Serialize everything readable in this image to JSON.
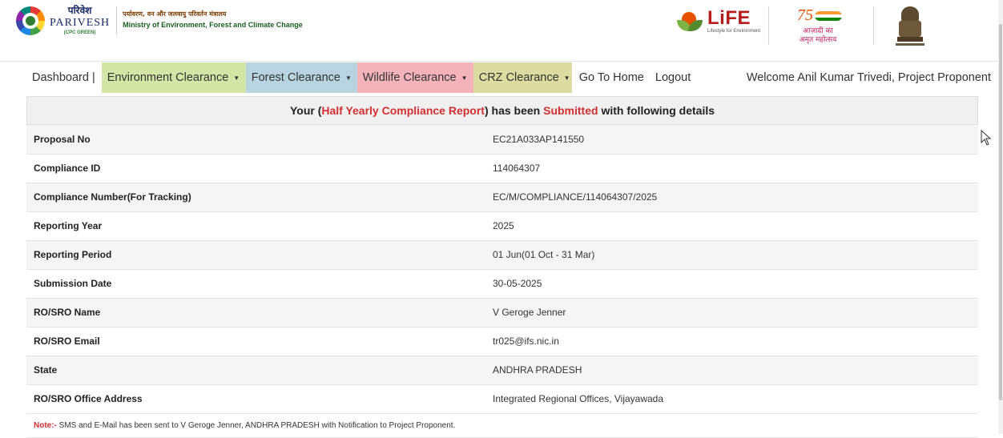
{
  "header": {
    "brand_hindi": "परिवेश",
    "brand_english": "PARIVESH",
    "brand_sub": "(CPC GREEN)",
    "ministry_hindi": "पर्यावरण, वन और जलवायु परिवर्तन मंत्रालय",
    "ministry_english": "Ministry of Environment, Forest and Climate Change",
    "life_logo": "LiFE",
    "life_sub": "Lifestyle for Environment",
    "azadi_line1": "आज़ादी का",
    "azadi_line2": "अमृत महोत्सव",
    "azadi_number": "75"
  },
  "nav": {
    "dashboard": "Dashboard |",
    "environment_clearance": "Environment Clearance",
    "forest_clearance": "Forest Clearance",
    "wildlife_clearance": "Wildlife Clearance",
    "crz_clearance": "CRZ Clearance",
    "go_to_home": "Go To Home",
    "logout": "Logout",
    "welcome": "Welcome Anil Kumar Trivedi, Project Proponent",
    "colors": {
      "environment": "#d3e6a6",
      "forest": "#b7d4e0",
      "wildlife": "#f4b3ba",
      "crz": "#dcdca0"
    }
  },
  "banner": {
    "prefix": "Your (",
    "report_type": "Half Yearly Compliance Report",
    "middle": ") has been ",
    "status": "Submitted",
    "suffix": " with following details",
    "highlight_color": "#d32f2f"
  },
  "details": [
    {
      "label": "Proposal No",
      "value": "EC21A033AP141550"
    },
    {
      "label": "Compliance ID",
      "value": "114064307"
    },
    {
      "label": "Compliance Number(For Tracking)",
      "value": "EC/M/COMPLIANCE/114064307/2025"
    },
    {
      "label": "Reporting Year",
      "value": "2025"
    },
    {
      "label": "Reporting Period",
      "value": "01 Jun(01 Oct - 31 Mar)"
    },
    {
      "label": "Submission Date",
      "value": "30-05-2025"
    },
    {
      "label": "RO/SRO Name",
      "value": "V Geroge Jenner"
    },
    {
      "label": "RO/SRO Email",
      "value": "tr025@ifs.nic.in"
    },
    {
      "label": "State",
      "value": "ANDHRA PRADESH"
    },
    {
      "label": "RO/SRO Office Address",
      "value": "Integrated Regional Offices, Vijayawada"
    }
  ],
  "note": {
    "label": "Note:-",
    "text": " SMS and E-Mail has been sent to V Geroge Jenner, ANDHRA PRADESH with Notification to Project Proponent."
  }
}
